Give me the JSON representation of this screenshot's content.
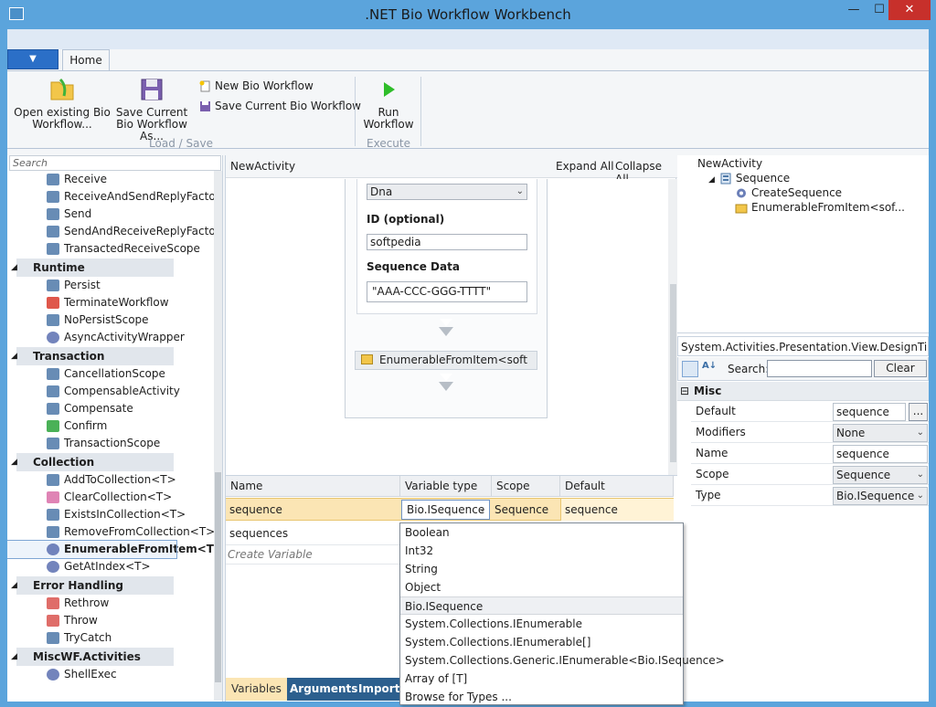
{
  "window": {
    "title": ".NET Bio Workflow Workbench",
    "minimize": "—",
    "maximize": "☐",
    "close": "✕"
  },
  "ribbon": {
    "app_menu": "▼",
    "tab_home": "Home",
    "open_existing": "Open existing Bio Workflow...",
    "save_current_as": "Save Current Bio Workflow As...",
    "new_workflow": "New Bio Workflow",
    "save_current": "Save Current Bio Workflow",
    "group_load_save": "Load / Save",
    "run_workflow": "Run Workflow",
    "group_execute": "Execute"
  },
  "toolbox": {
    "search_placeholder": "Search",
    "items": [
      {
        "label": "Receive",
        "type": "item",
        "icon": "receive-icon"
      },
      {
        "label": "ReceiveAndSendReplyFactory",
        "type": "item",
        "icon": "receive-send-icon"
      },
      {
        "label": "Send",
        "type": "item",
        "icon": "send-icon"
      },
      {
        "label": "SendAndReceiveReplyFactory",
        "type": "item",
        "icon": "send-receive-icon"
      },
      {
        "label": "TransactedReceiveScope",
        "type": "item",
        "icon": "scope-icon"
      },
      {
        "label": "Runtime",
        "type": "category"
      },
      {
        "label": "Persist",
        "type": "item",
        "icon": "persist-icon"
      },
      {
        "label": "TerminateWorkflow",
        "type": "item",
        "icon": "terminate-icon"
      },
      {
        "label": "NoPersistScope",
        "type": "item",
        "icon": "nopersist-icon"
      },
      {
        "label": "AsyncActivityWrapper",
        "type": "item",
        "icon": "gear-icon"
      },
      {
        "label": "Transaction",
        "type": "category"
      },
      {
        "label": "CancellationScope",
        "type": "item",
        "icon": "cancel-scope-icon"
      },
      {
        "label": "CompensableActivity",
        "type": "item",
        "icon": "compensable-icon"
      },
      {
        "label": "Compensate",
        "type": "item",
        "icon": "compensate-icon"
      },
      {
        "label": "Confirm",
        "type": "item",
        "icon": "check-icon"
      },
      {
        "label": "TransactionScope",
        "type": "item",
        "icon": "scope-icon"
      },
      {
        "label": "Collection",
        "type": "category"
      },
      {
        "label": "AddToCollection<T>",
        "type": "item",
        "icon": "add-collection-icon"
      },
      {
        "label": "ClearCollection<T>",
        "type": "item",
        "icon": "eraser-icon"
      },
      {
        "label": "ExistsInCollection<T>",
        "type": "item",
        "icon": "check-list-icon"
      },
      {
        "label": "RemoveFromCollection<T>",
        "type": "item",
        "icon": "remove-collection-icon"
      },
      {
        "label": "EnumerableFromItem<T>",
        "type": "item",
        "icon": "gear-icon",
        "selected": true
      },
      {
        "label": "GetAtIndex<T>",
        "type": "item",
        "icon": "gear-icon"
      },
      {
        "label": "Error Handling",
        "type": "category"
      },
      {
        "label": "Rethrow",
        "type": "item",
        "icon": "rethrow-icon"
      },
      {
        "label": "Throw",
        "type": "item",
        "icon": "throw-icon"
      },
      {
        "label": "TryCatch",
        "type": "item",
        "icon": "trycatch-icon"
      },
      {
        "label": "MiscWF.Activities",
        "type": "category"
      },
      {
        "label": "ShellExec",
        "type": "item",
        "icon": "gear-icon"
      }
    ]
  },
  "designer": {
    "breadcrumb": "NewActivity",
    "expand_all": "Expand All",
    "collapse_all": "Collapse All",
    "alphabet_value": "Dna",
    "id_label": "ID (optional)",
    "id_value": "softpedia",
    "sequence_data_label": "Sequence Data",
    "sequence_data_value": "\"AAA-CCC-GGG-TTTT\"",
    "enumerable_activity": "EnumerableFromItem<soft"
  },
  "variables": {
    "headers": [
      "Name",
      "Variable type",
      "Scope",
      "Default"
    ],
    "rows": [
      {
        "name": "sequence",
        "type": "Bio.ISequence",
        "scope": "Sequence",
        "default": "sequence"
      },
      {
        "name": "sequences",
        "type": "",
        "scope": "",
        "default": ""
      }
    ],
    "create_placeholder": "Create Variable",
    "tabs": [
      "Variables",
      "Arguments",
      "Imports"
    ]
  },
  "type_dropdown": {
    "options": [
      "Boolean",
      "Int32",
      "String",
      "Object",
      "Bio.ISequence",
      "System.Collections.IEnumerable",
      "System.Collections.IEnumerable[]",
      "System.Collections.Generic.IEnumerable<Bio.ISequence>",
      "Array of [T]",
      "Browse for Types ..."
    ],
    "highlighted_index": 4
  },
  "outline": {
    "root": "NewActivity",
    "sequence": "Sequence",
    "child1": "CreateSequence",
    "child2": "EnumerableFromItem<sof..."
  },
  "properties": {
    "title": "System.Activities.Presentation.View.DesignTime...",
    "search_label": "Search:",
    "clear": "Clear",
    "category": "Misc",
    "rows": [
      {
        "name": "Default",
        "value": "sequence",
        "kind": "text-ellipsis"
      },
      {
        "name": "Modifiers",
        "value": "None",
        "kind": "combo"
      },
      {
        "name": "Name",
        "value": "sequence",
        "kind": "text"
      },
      {
        "name": "Scope",
        "value": "Sequence",
        "kind": "combo"
      },
      {
        "name": "Type",
        "value": "Bio.ISequence",
        "kind": "combo"
      }
    ],
    "ellipsis": "..."
  },
  "colors": {
    "titlebar": "#5ba4dc",
    "close": "#c7302b",
    "selected_row": "#fbe5b4",
    "bottom_tabs": "#2c5f8e"
  }
}
